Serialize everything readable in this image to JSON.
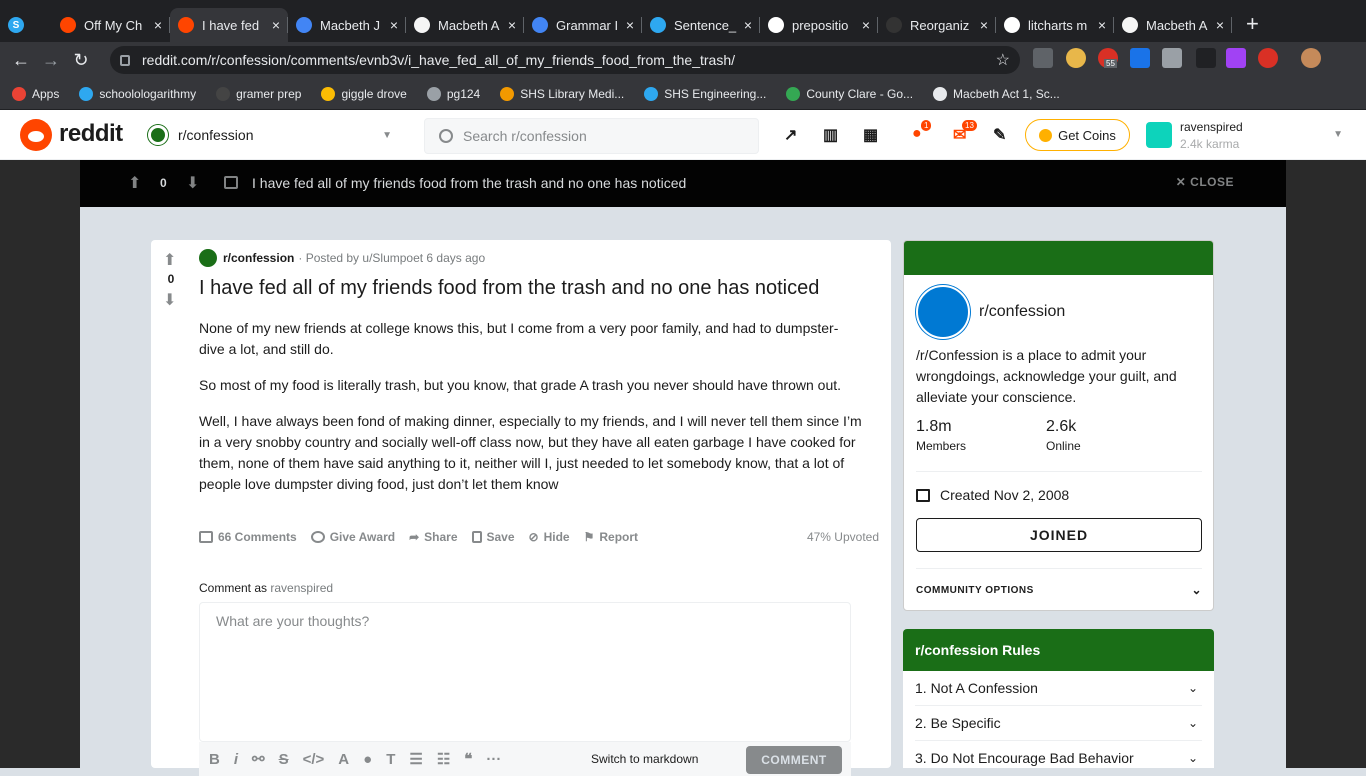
{
  "browser": {
    "tabs": [
      {
        "title": "Off My Ch",
        "color": "#ff4500",
        "active": false
      },
      {
        "title": "I have fed",
        "color": "#ff4500",
        "active": true
      },
      {
        "title": "Macbeth J",
        "color": "#4285f4",
        "active": false
      },
      {
        "title": "Macbeth A",
        "color": "#f5f5f5",
        "active": false
      },
      {
        "title": "Grammar I",
        "color": "#4285f4",
        "active": false
      },
      {
        "title": "Sentence_",
        "color": "#2ea8f0",
        "active": false
      },
      {
        "title": "prepositio",
        "color": "#ffffff",
        "active": false
      },
      {
        "title": "Reorganiz",
        "color": "#333333",
        "active": false
      },
      {
        "title": "litcharts m",
        "color": "#ffffff",
        "active": false
      },
      {
        "title": "Macbeth A",
        "color": "#f5f5f5",
        "active": false
      }
    ],
    "url": "reddit.com/r/confession/comments/evnb3v/i_have_fed_all_of_my_friends_food_from_the_trash/",
    "bookmarks": [
      {
        "label": "Apps",
        "color": "#ea4335"
      },
      {
        "label": "schoolologarithmy",
        "color": "#2ea8f0"
      },
      {
        "label": "gramer prep",
        "color": "#444444"
      },
      {
        "label": "giggle drove",
        "color": "#fbbc04"
      },
      {
        "label": "pg124",
        "color": "#9aa0a6"
      },
      {
        "label": "SHS Library Medi...",
        "color": "#f29900"
      },
      {
        "label": "SHS Engineering...",
        "color": "#2ea8f0"
      },
      {
        "label": "County Clare - Go...",
        "color": "#34a853"
      },
      {
        "label": "Macbeth Act 1, Sc...",
        "color": "#e8eaed"
      }
    ],
    "extension_badge": "55"
  },
  "header": {
    "wordmark": "reddit",
    "subreddit": "r/confession",
    "search_placeholder": "Search r/confession",
    "chat_badge": "1",
    "mail_badge": "13",
    "coins_label": "Get Coins",
    "username": "ravenspired",
    "karma": "2.4k karma"
  },
  "overlay": {
    "score": "0",
    "title": "I have fed all of my friends food from the trash and no one has noticed",
    "close_label": "CLOSE"
  },
  "post": {
    "score": "0",
    "subreddit": "r/confession",
    "posted_by": "· Posted by u/Slumpoet 6 days ago",
    "title": "I have fed all of my friends food from the trash and no one has noticed",
    "paragraphs": [
      "None of my new friends at college knows this, but I come from a very poor family, and had to dumpster-dive a lot, and still do.",
      "So most of my food is literally trash, but you know, that grade A trash you never should have thrown out.",
      "Well, I have always been fond of making dinner, especially to my friends, and I will never tell them since I’m in a very snobby country and socially well-off class now, but they have all eaten garbage I have cooked for them, none of them have said anything to it, neither will I, just needed to let somebody know, that a lot of people love dumpster diving food, just don’t let them know"
    ],
    "actions": {
      "comments": "66 Comments",
      "award": "Give Award",
      "share": "Share",
      "save": "Save",
      "hide": "Hide",
      "report": "Report",
      "upvoted": "47% Upvoted"
    },
    "comment_as_label": "Comment as",
    "comment_as_user": "ravenspired",
    "comment_placeholder": "What are your thoughts?",
    "markdown_switch": "Switch to markdown",
    "comment_button": "COMMENT"
  },
  "community": {
    "name": "r/confession",
    "description": "/r/Confession is a place to admit your wrongdoings, acknowledge your guilt, and alleviate your conscience.",
    "members": "1.8m",
    "members_label": "Members",
    "online": "2.6k",
    "online_label": "Online",
    "created": "Created Nov 2, 2008",
    "joined_label": "JOINED",
    "options_label": "COMMUNITY OPTIONS",
    "banner_color": "#1a6e17"
  },
  "rules": {
    "title": "r/confession Rules",
    "items": [
      "1. Not A Confession",
      "2. Be Specific",
      "3. Do Not Encourage Bad Behavior"
    ]
  }
}
